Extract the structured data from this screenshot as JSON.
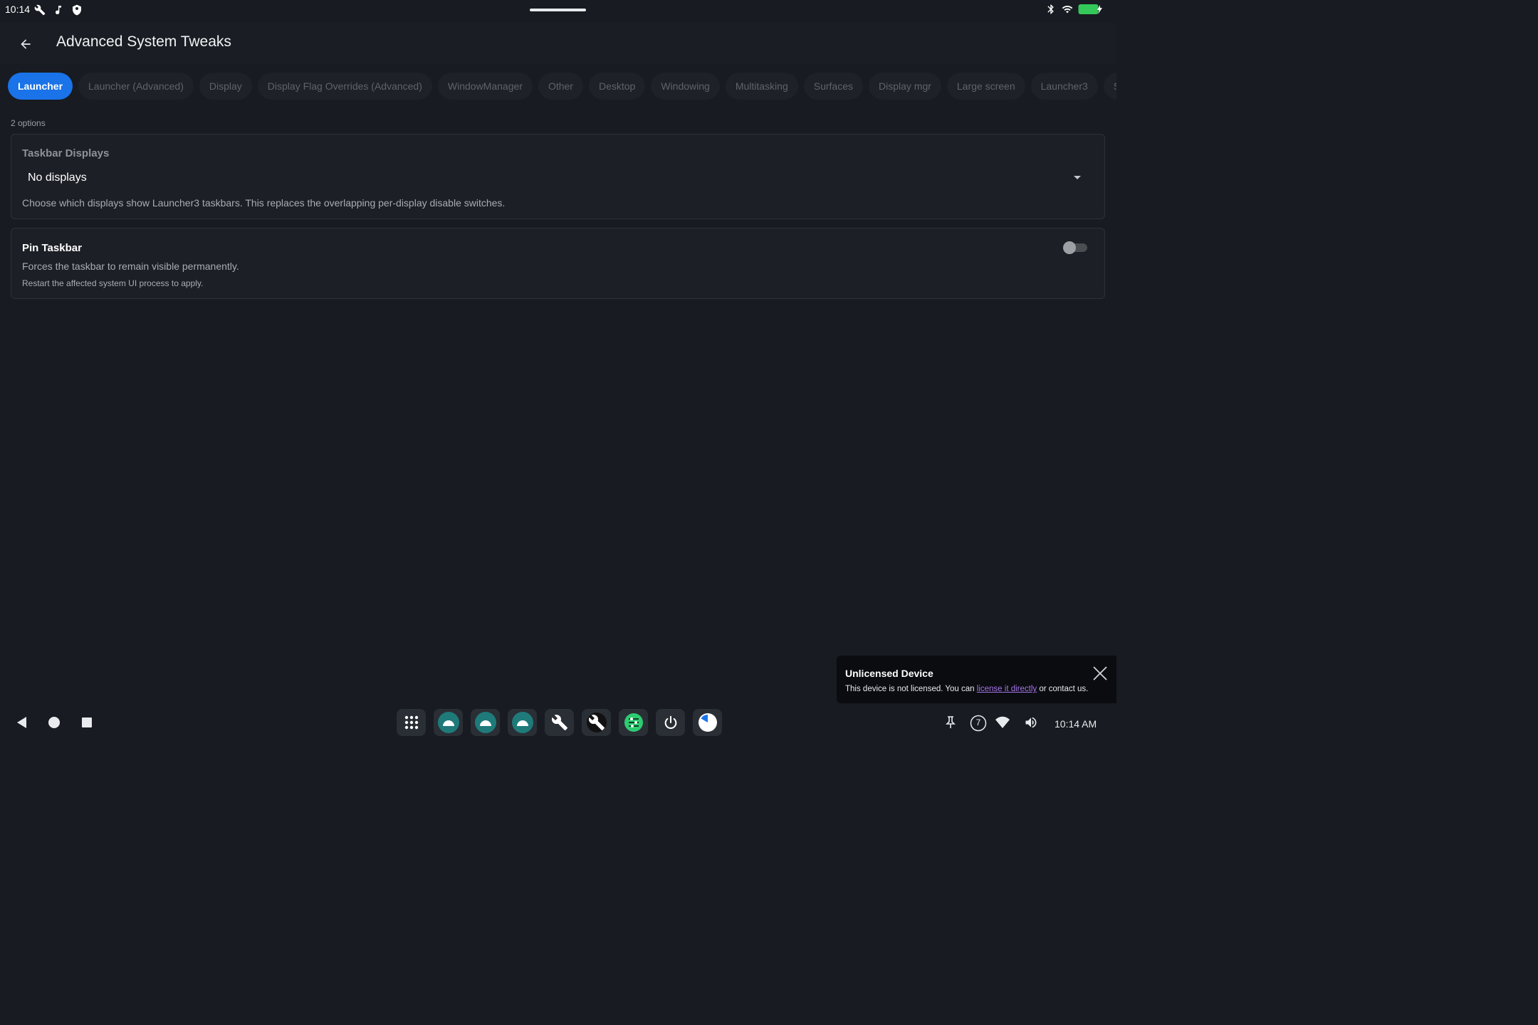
{
  "status_bar": {
    "time": "10:14",
    "left_icons": [
      "wrench-icon",
      "music-note-icon",
      "shield-icon"
    ],
    "right_icons": [
      "bluetooth-icon",
      "wifi-icon",
      "battery-charging-icon"
    ],
    "battery_color": "#34c759"
  },
  "app_bar": {
    "title": "Advanced System Tweaks",
    "back_icon": "arrow-left-icon"
  },
  "tabs": [
    {
      "label": "Launcher",
      "active": true
    },
    {
      "label": "Launcher (Advanced)"
    },
    {
      "label": "Display"
    },
    {
      "label": "Display Flag Overrides (Advanced)"
    },
    {
      "label": "WindowManager"
    },
    {
      "label": "Other"
    },
    {
      "label": "Desktop"
    },
    {
      "label": "Windowing"
    },
    {
      "label": "Multitasking"
    },
    {
      "label": "Surfaces"
    },
    {
      "label": "Display mgr"
    },
    {
      "label": "Large screen"
    },
    {
      "label": "Launcher3"
    },
    {
      "label": "Sys"
    }
  ],
  "options_count": "2 options",
  "settings": {
    "taskbar_displays": {
      "title": "Taskbar Displays",
      "value": "No displays",
      "description": "Choose which displays show Launcher3 taskbars. This replaces the overlapping per-display disable switches."
    },
    "pin_taskbar": {
      "title": "Pin Taskbar",
      "enabled": false,
      "description": "Forces the taskbar to remain visible permanently.",
      "note": "Restart the affected system UI process to apply."
    }
  },
  "toast": {
    "title": "Unlicensed Device",
    "body_prefix": "This device is not licensed. You can ",
    "link": "license it directly",
    "body_suffix": " or contact us."
  },
  "taskbar": {
    "nav": [
      "back-triangle-icon",
      "home-circle-icon",
      "recents-square-icon"
    ],
    "apps": [
      "app-drawer-icon",
      "android-app-icon",
      "android-app-icon",
      "android-app-icon",
      "wrench-icon",
      "wrench-dark-icon",
      "settings-sliders-icon",
      "power-icon",
      "pie-chart-icon"
    ],
    "tray": [
      "pin-icon",
      "notification-count-icon",
      "wifi-icon",
      "volume-icon"
    ],
    "notification_count": "7",
    "clock": "10:14 AM"
  },
  "colors": {
    "accent": "#1a73e8",
    "background": "#181b21",
    "link": "#a674e8"
  }
}
